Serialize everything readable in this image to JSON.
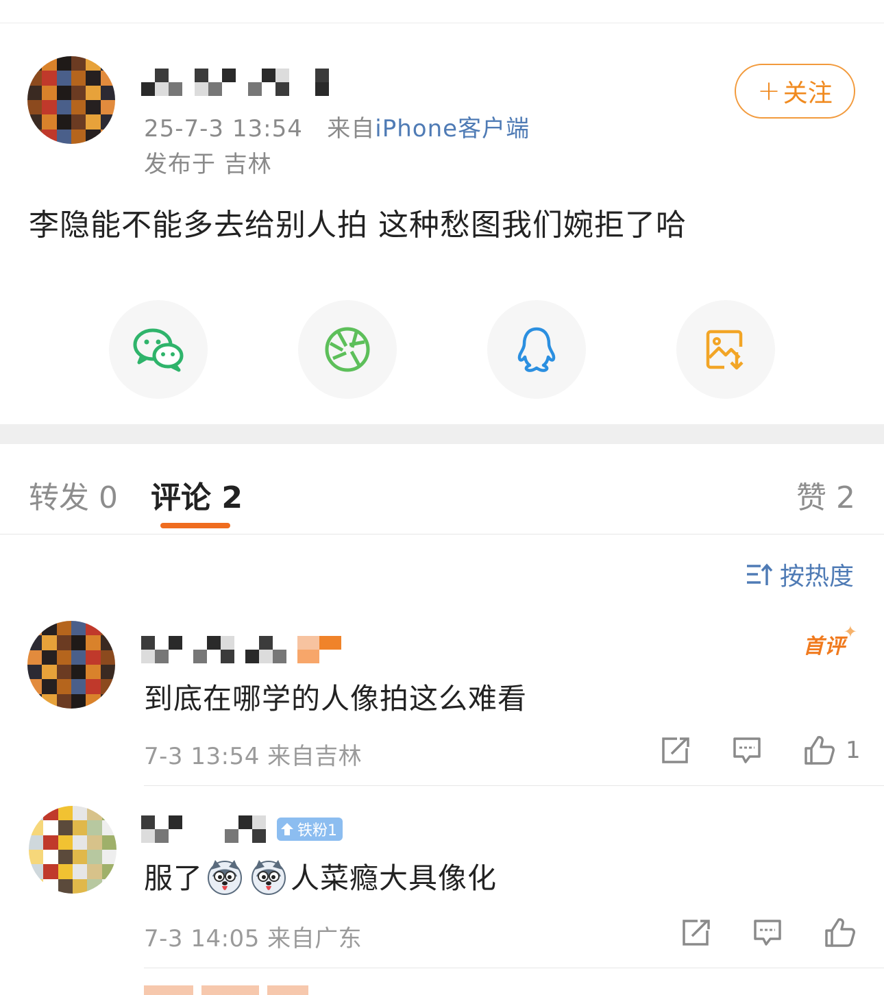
{
  "post": {
    "timestamp": "25-7-3 13:54",
    "from_prefix": "来自",
    "client": "iPhone客户端",
    "location": "发布于 吉林",
    "follow_label": "关注",
    "text": "李隐能不能多去给别人拍 这种愁图我们婉拒了哈"
  },
  "share": {
    "items": [
      {
        "icon": "wechat-icon",
        "color": "#2fb46b"
      },
      {
        "icon": "moments-icon",
        "color": "#5dbf5a"
      },
      {
        "icon": "qq-icon",
        "color": "#2b8fe0"
      },
      {
        "icon": "save-image-icon",
        "color": "#f2a526"
      }
    ]
  },
  "tabs": {
    "repost": "转发 0",
    "comments": "评论 2",
    "likes": "赞 2"
  },
  "sort_label": "按热度",
  "comments": [
    {
      "badge": "首评",
      "text": "到底在哪学的人像拍这么难看",
      "meta": "7-3 13:54  来自吉林",
      "like_count": "1"
    },
    {
      "fan_badge": "铁粉1",
      "text_before": "服了",
      "text_after": "人菜瘾大具像化",
      "meta": "7-3 14:05  来自广东",
      "like_count": ""
    }
  ],
  "colors": {
    "accent": "#ef6c1f",
    "link": "#4f7bb5",
    "follow": "#f08a1f"
  }
}
